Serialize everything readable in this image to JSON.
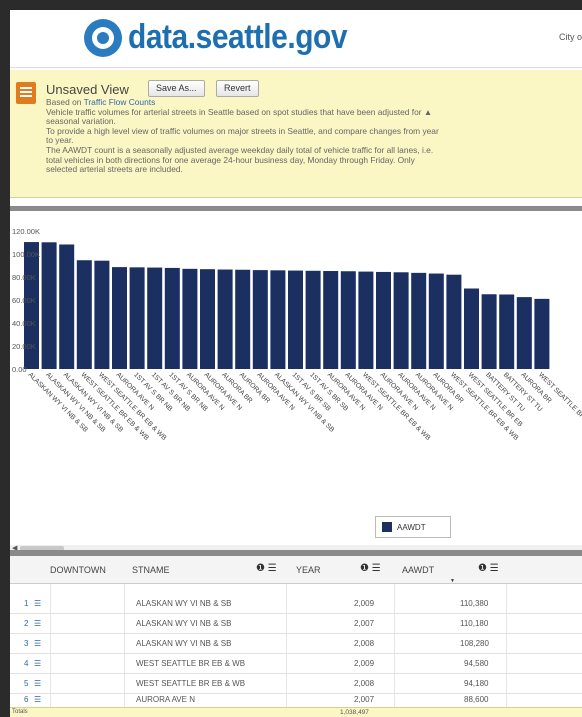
{
  "header": {
    "site_name": "data.seattle.gov",
    "city_link": "City o"
  },
  "view": {
    "title": "Unsaved View",
    "save_as_label": "Save As...",
    "revert_label": "Revert",
    "based_on_prefix": "Based on",
    "based_on_link": "Traffic Flow Counts",
    "description_lines": [
      "Vehicle traffic volumes for arterial streets in Seattle based on spot studies that have been adjusted for ▲",
      "seasonal variation.",
      "To provide a high level view of traffic volumes on major streets in Seattle, and compare changes from year",
      "to year.",
      "The AAWDT count is a seasonally adjusted average weekday daily total of vehicle traffic for all lanes, i.e.",
      "total vehicles in both directions for one average 24-hour business day, Monday through Friday. Only",
      "selected arterial streets are included."
    ]
  },
  "chart_data": {
    "type": "bar",
    "title": "",
    "xlabel": "",
    "ylabel": "",
    "ylim": [
      0,
      120000
    ],
    "y_ticks": [
      "0.00",
      "20.00K",
      "40.00K",
      "60.00K",
      "80.00K",
      "100.00K",
      "120.00K"
    ],
    "grid": false,
    "legend_position": "bottom-right",
    "categories": [
      "ALASKAN WY VI NB & SB",
      "ALASKAN WY VI NB & SB",
      "ALASKAN WY VI NB & SB",
      "WEST SEATTLE BR EB & WB",
      "WEST SEATTLE BR EB & WB",
      "AURORA AVE N",
      "1ST AV S BR NB",
      "1ST AV S BR NB",
      "1ST AV S BR NB",
      "AURORA AVE N",
      "AURORA AVE N",
      "AURORA BR",
      "AURORA BR",
      "AURORA AVE N",
      "ALASKAN WY VI NB & SB",
      "1ST AV S BR SB",
      "1ST AV S BR SB",
      "AURORA AVE N",
      "AURORA AVE N",
      "WEST SEATTLE BR EB & WB",
      "AURORA AVE N",
      "AURORA AVE N",
      "AURORA AVE N",
      "AURORA BR",
      "WEST SEATTLE BR EB & WB",
      "WEST SEATTLE BR EB",
      "BATTERY ST TU",
      "BATTERY ST TU",
      "AURORA BR",
      "WEST SEATTLE BR EB & WB"
    ],
    "series": [
      {
        "name": "AAWDT",
        "color": "#1b2f61",
        "values": [
          110380,
          110180,
          108280,
          94580,
          94180,
          88600,
          88400,
          88200,
          87900,
          87100,
          86800,
          86500,
          86300,
          86000,
          85800,
          85600,
          85400,
          85200,
          85000,
          84700,
          84400,
          84100,
          83600,
          83000,
          82000,
          70000,
          65000,
          64800,
          62500,
          61000
        ]
      }
    ]
  },
  "scroll": {
    "left_arrow": "◀"
  },
  "table": {
    "columns": [
      {
        "label": "DOWNTOWN"
      },
      {
        "label": "STNAME"
      },
      {
        "label": "YEAR"
      },
      {
        "label": "AAWDT"
      }
    ],
    "column_icons": "❶ ☰",
    "sort_indicator": "▼",
    "row_icon": "☰",
    "rows": [
      {
        "num": "1",
        "downtown": "",
        "stname": "ALASKAN WY VI NB & SB",
        "year": "2,009",
        "aawdt": "110,380"
      },
      {
        "num": "2",
        "downtown": "",
        "stname": "ALASKAN WY VI NB & SB",
        "year": "2,007",
        "aawdt": "110,180"
      },
      {
        "num": "3",
        "downtown": "",
        "stname": "ALASKAN WY VI NB & SB",
        "year": "2,008",
        "aawdt": "108,280"
      },
      {
        "num": "4",
        "downtown": "",
        "stname": "WEST SEATTLE BR EB & WB",
        "year": "2,009",
        "aawdt": "94,580"
      },
      {
        "num": "5",
        "downtown": "",
        "stname": "WEST SEATTLE BR EB & WB",
        "year": "2,008",
        "aawdt": "94,180"
      }
    ],
    "partial_row": {
      "num": "6",
      "stname": "AURORA AVE N",
      "year": "2,007",
      "aawdt": "88,600"
    },
    "totals_label": "Totals",
    "totals_value": "1,038,497"
  }
}
